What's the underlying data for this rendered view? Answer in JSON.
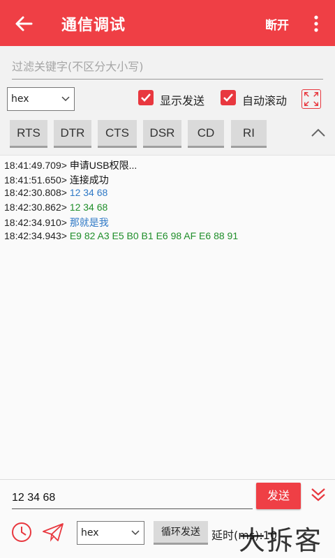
{
  "header": {
    "title": "通信调试",
    "disconnect_label": "断开"
  },
  "filter": {
    "placeholder": "过滤关键字(不区分大小写)"
  },
  "options": {
    "format_value": "hex",
    "show_send_label": "显示发送",
    "show_send_checked": true,
    "auto_scroll_label": "自动滚动",
    "auto_scroll_checked": true
  },
  "signals": [
    "RTS",
    "DTR",
    "CTS",
    "DSR",
    "CD",
    "RI"
  ],
  "log": [
    {
      "time": "18:41:49.709>",
      "text": "申请USB权限...",
      "color": "#111111"
    },
    {
      "time": "18:41:51.650>",
      "text": "连接成功",
      "color": "#111111"
    },
    {
      "time": "18:42:30.808>",
      "text": "12 34 68",
      "color": "#2f79c6"
    },
    {
      "time": "18:42:30.862>",
      "text": "12 34 68",
      "color": "#1f8e2a"
    },
    {
      "time": "18:42:34.910>",
      "text": "那就是我",
      "color": "#2f79c6"
    },
    {
      "time": "18:42:34.943>",
      "text": "E9 82 A3 E5 B0 B1 E6 98 AF E6 88 91",
      "color": "#1f8e2a"
    }
  ],
  "send": {
    "input_value": "12 34 68",
    "send_label": "发送",
    "format_value": "hex",
    "loop_label": "循环发送",
    "delay_label": "延时(ms):10"
  },
  "watermark": "大拆客",
  "colors": {
    "accent": "#ef3f45",
    "sent": "#2f79c6",
    "received": "#1f8e2a"
  },
  "icons": {
    "back": "arrow-left-icon",
    "more": "more-vertical-icon",
    "fullscreen": "fullscreen-icon",
    "collapse": "chevron-up-icon",
    "expand": "double-chevron-down-icon",
    "clock": "clock-icon",
    "send": "paper-plane-icon"
  }
}
